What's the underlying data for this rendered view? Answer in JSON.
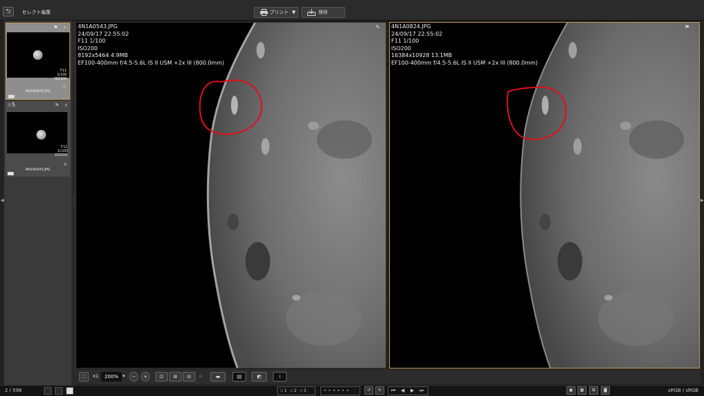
{
  "header": {
    "back_glyph": "⮌",
    "title": "セレクト編集",
    "print_label": "プリント",
    "print_dropdown": "▼",
    "save_label": "保存"
  },
  "thumbnails": [
    {
      "filename": "4N1A0824.JPG",
      "aperture": "F11",
      "shutter": "1/100",
      "iso": "ISO200",
      "selected": true,
      "rating": ""
    },
    {
      "filename": "4N1A0543.JPG",
      "aperture": "F11",
      "shutter": "1/100",
      "iso": "ISO200",
      "selected": false,
      "rating": "5"
    }
  ],
  "panes": {
    "left": {
      "filename": "4N1A0543.JPG",
      "datetime": "24/09/17 22:55:02",
      "exposure": "F11 1/100",
      "iso": "ISO200",
      "size": "8192x5464 4.9MB",
      "lens": "EF100-400mm f/4.5-5.6L IS II USM +2x III (800.0mm)"
    },
    "right": {
      "filename": "4N1A0824.JPG",
      "datetime": "24/09/17 22:55:02",
      "exposure": "F11 1/100",
      "iso": "ISO200",
      "size": "16384x10928 13.1MB",
      "lens": "EF100-400mm f/4.5-5.6L IS II USM +2x III (800.0mm)"
    }
  },
  "toolbar": {
    "fit_label": "⛶",
    "x1_label": "x1",
    "zoom_value": "200%",
    "zoom_out": "−",
    "zoom_in": "+",
    "info_label": "i"
  },
  "statusbar": {
    "count": "2 / 598",
    "ratings": "☆1 ☆2 ☆3 ☆4 ☆5",
    "dots": "••••••",
    "color_space": "sRGB / sRGB"
  },
  "colors": {
    "selection_border": "#c69a58",
    "annotation_red": "#e0101a"
  },
  "icons": [
    "back-icon",
    "printer-icon",
    "save-icon",
    "flag-icon",
    "pin-icon",
    "zoom-icon",
    "gear-icon",
    "card-icon"
  ]
}
